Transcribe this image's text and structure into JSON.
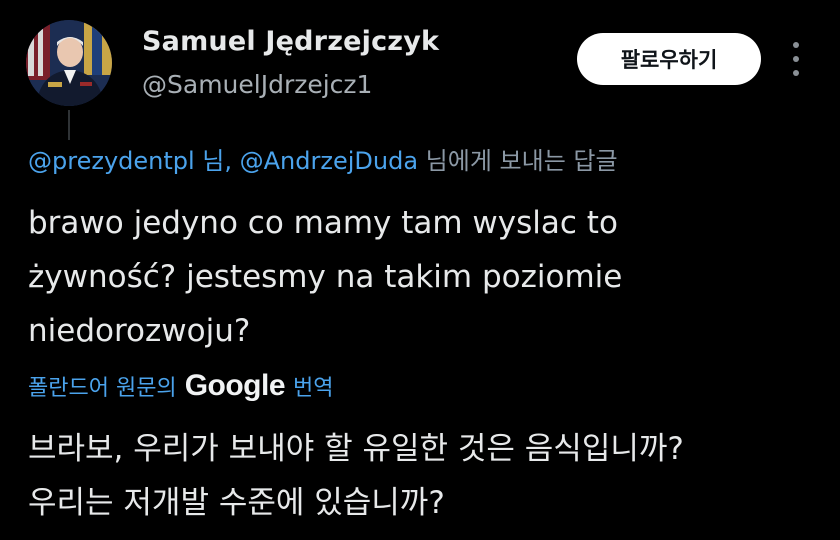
{
  "author": {
    "name": "Samuel Jędrzejczyk",
    "handle": "@SamuelJdrzejcz1"
  },
  "follow_button_label": "팔로우하기",
  "more_icon": "more-vertical-icon",
  "reply_to": {
    "mentions": "@prezydentpl 님, @AndrzejDuda",
    "suffix": " 님에게 보내는 답글"
  },
  "tweet_lines": [
    "brawo jedyno co mamy tam wyslac to",
    "żywność?  jestesmy na takim poziomie",
    "niedorozwoju?"
  ],
  "translate": {
    "prefix": "폴란드어 원문의",
    "provider": "Google",
    "suffix": "번역"
  },
  "translated_lines": [
    "브라보, 우리가 보내야 할 유일한 것은 음식입니까?",
    "우리는 저개발 수준에 있습니까?"
  ],
  "colors": {
    "background": "#000000",
    "link": "#4ba3ec",
    "text": "#e7e9ea",
    "secondary": "#8b98a5"
  }
}
